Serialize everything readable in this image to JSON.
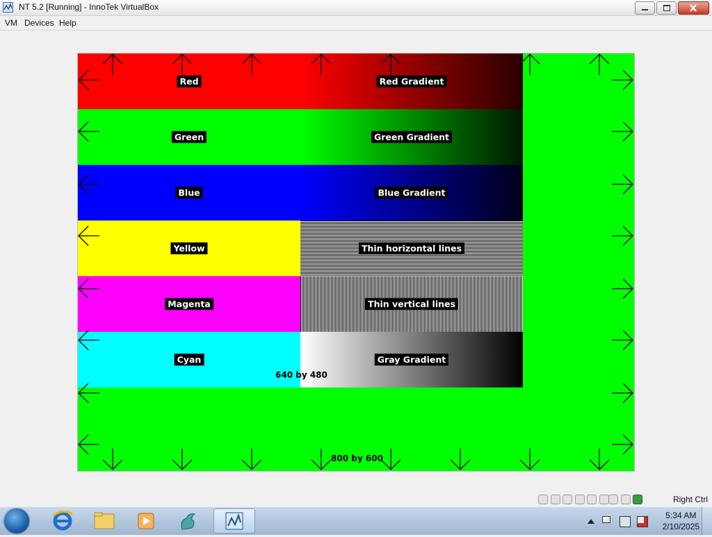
{
  "window": {
    "title": "NT 5.2 [Running] - InnoTek VirtualBox"
  },
  "menu": [
    {
      "label": "VM"
    },
    {
      "label": "Devices"
    },
    {
      "label": "Help"
    }
  ],
  "testpattern": {
    "bands": [
      {
        "label": "Red",
        "gradient_label": "Red Gradient",
        "color": "#ff0000"
      },
      {
        "label": "Green",
        "gradient_label": "Green Gradient",
        "color": "#00ff00"
      },
      {
        "label": "Blue",
        "gradient_label": "Blue Gradient",
        "color": "#0000ff"
      },
      {
        "label": "Yellow",
        "gradient_label": "Thin horizontal lines",
        "color": "#ffff00"
      },
      {
        "label": "Magenta",
        "gradient_label": "Thin vertical lines",
        "color": "#ff00ff"
      },
      {
        "label": "Cyan",
        "gradient_label": "Gray Gradient",
        "color": "#00ffff"
      }
    ],
    "inner_resolution": "640 by 480",
    "outer_resolution": "800 by 600",
    "background_color": "#00ff00"
  },
  "statusbar": {
    "icons": [
      "hard-disk-icon",
      "cd-icon",
      "floppy-icon",
      "network-icon",
      "usb-icon",
      "shared-folder-icon",
      "display-icon",
      "mouse-integration-icon",
      "capture-icon"
    ],
    "host_key": "Right Ctrl"
  },
  "taskbar": {
    "items": [
      "start-orb-icon",
      "internet-explorer-icon",
      "explorer-folder-icon",
      "media-player-icon",
      "dragon-app-icon",
      "virtualbox-icon"
    ],
    "tray_icons": [
      "show-hidden-icons",
      "action-center-flag-icon",
      "network-tray-icon",
      "volume-muted-icon"
    ],
    "time": "5:34 AM",
    "date": "2/10/2025"
  }
}
